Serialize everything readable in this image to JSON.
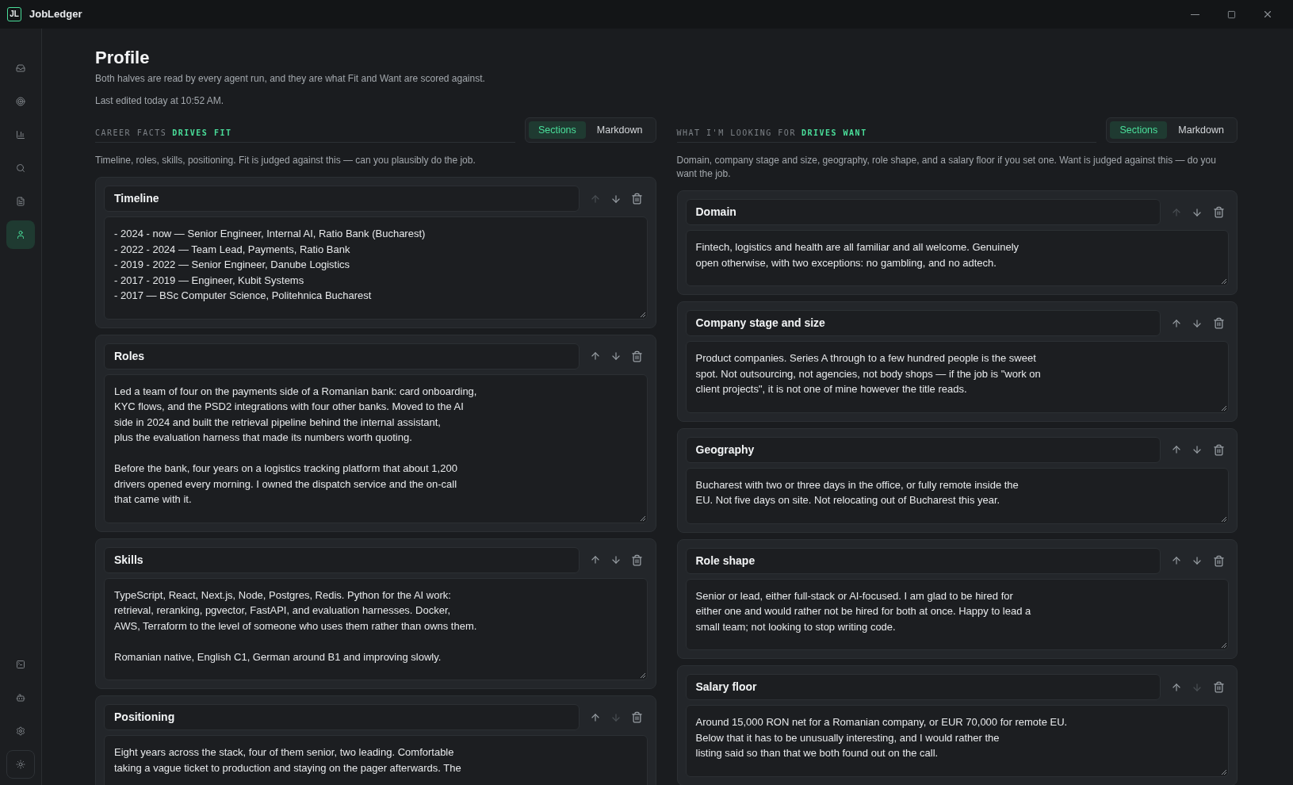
{
  "app": {
    "logo": "JL",
    "title": "JobLedger"
  },
  "sidebar": {
    "items": [
      {
        "selected": false
      },
      {
        "selected": false
      },
      {
        "selected": false
      },
      {
        "selected": false
      },
      {
        "selected": false
      },
      {
        "selected": true
      }
    ],
    "bottom_items": [
      {
        "selected": false
      },
      {
        "selected": false
      },
      {
        "selected": false
      },
      {
        "selected": false
      }
    ]
  },
  "page": {
    "title": "Profile",
    "subtitle": "Both halves are read by every agent run, and they are what Fit and Want are scored against.",
    "last_edited": "Last edited today at 10:52 AM."
  },
  "columns": [
    {
      "label": "CAREER FACTS",
      "accent": "DRIVES FIT",
      "toggle": [
        {
          "label": "Sections",
          "selected": true
        },
        {
          "label": "Markdown",
          "selected": false
        }
      ],
      "description": "Timeline, roles, skills, positioning. Fit is judged against this — can you plausibly do the job.",
      "sections": [
        {
          "title": "Timeline",
          "up_disabled": true,
          "down_disabled": false,
          "body": "- 2024 - now — Senior Engineer, Internal AI, Ratio Bank (Bucharest)\n- 2022 - 2024 — Team Lead, Payments, Ratio Bank\n- 2019 - 2022 — Senior Engineer, Danube Logistics\n- 2017 - 2019 — Engineer, Kubit Systems\n- 2017 — BSc Computer Science, Politehnica Bucharest"
        },
        {
          "title": "Roles",
          "up_disabled": false,
          "down_disabled": false,
          "body": "Led a team of four on the payments side of a Romanian bank: card onboarding,\nKYC flows, and the PSD2 integrations with four other banks. Moved to the AI\nside in 2024 and built the retrieval pipeline behind the internal assistant,\nplus the evaluation harness that made its numbers worth quoting.\n\nBefore the bank, four years on a logistics tracking platform that about 1,200\ndrivers opened every morning. I owned the dispatch service and the on-call\nthat came with it."
        },
        {
          "title": "Skills",
          "up_disabled": false,
          "down_disabled": false,
          "body": "TypeScript, React, Next.js, Node, Postgres, Redis. Python for the AI work:\nretrieval, reranking, pgvector, FastAPI, and evaluation harnesses. Docker,\nAWS, Terraform to the level of someone who uses them rather than owns them.\n\nRomanian native, English C1, German around B1 and improving slowly."
        },
        {
          "title": "Positioning",
          "up_disabled": false,
          "down_disabled": true,
          "body": "Eight years across the stack, four of them senior, two leading. Comfortable\ntaking a vague ticket to production and staying on the pager afterwards. The"
        }
      ]
    },
    {
      "label": "WHAT I'M LOOKING FOR",
      "accent": "DRIVES WANT",
      "toggle": [
        {
          "label": "Sections",
          "selected": true
        },
        {
          "label": "Markdown",
          "selected": false
        }
      ],
      "description": "Domain, company stage and size, geography, role shape, and a salary floor if you set one. Want is judged against this — do you want the job.",
      "sections": [
        {
          "title": "Domain",
          "up_disabled": true,
          "down_disabled": false,
          "body": "Fintech, logistics and health are all familiar and all welcome. Genuinely\nopen otherwise, with two exceptions: no gambling, and no adtech."
        },
        {
          "title": "Company stage and size",
          "up_disabled": false,
          "down_disabled": false,
          "body": "Product companies. Series A through to a few hundred people is the sweet\nspot. Not outsourcing, not agencies, not body shops — if the job is \"work on\nclient projects\", it is not one of mine however the title reads."
        },
        {
          "title": "Geography",
          "up_disabled": false,
          "down_disabled": false,
          "body": "Bucharest with two or three days in the office, or fully remote inside the\nEU. Not five days on site. Not relocating out of Bucharest this year."
        },
        {
          "title": "Role shape",
          "up_disabled": false,
          "down_disabled": false,
          "body": "Senior or lead, either full-stack or AI-focused. I am glad to be hired for\neither one and would rather not be hired for both at once. Happy to lead a\nsmall team; not looking to stop writing code."
        },
        {
          "title": "Salary floor",
          "up_disabled": false,
          "down_disabled": true,
          "body": "Around 15,000 RON net for a Romanian company, or EUR 70,000 for remote EU.\nBelow that it has to be unusually interesting, and I would rather the\nlisting said so than that we both found out on the call."
        }
      ]
    }
  ]
}
